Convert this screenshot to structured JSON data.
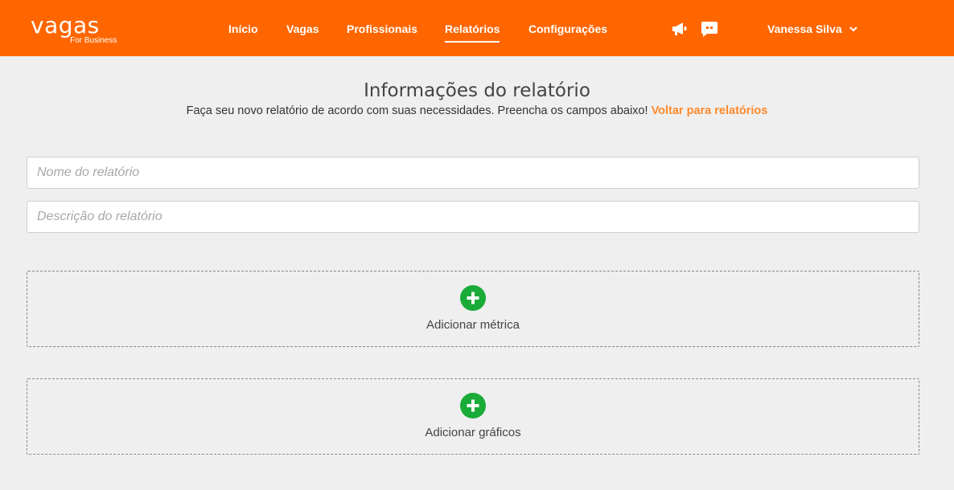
{
  "app": {
    "logo_main": "vagas",
    "logo_sub": "For Business"
  },
  "nav": {
    "items": [
      {
        "label": "Início"
      },
      {
        "label": "Vagas"
      },
      {
        "label": "Profissionais"
      },
      {
        "label": "Relatórios",
        "active": true
      },
      {
        "label": "Configurações"
      }
    ]
  },
  "header_icons": [
    "megaphone-icon",
    "chat-icon"
  ],
  "user": {
    "name": "Vanessa Silva"
  },
  "page": {
    "title": "Informações do relatório",
    "subtitle": "Faça seu novo relatório de acordo com suas necessidades. Preencha os campos abaixo!",
    "back_link": "Voltar para relatórios"
  },
  "form": {
    "name_placeholder": "Nome do relatório",
    "name_value": "",
    "description_placeholder": "Descrição do relatório",
    "description_value": ""
  },
  "actions": {
    "add_metric": "Adicionar métrica",
    "add_charts": "Adicionar gráficos"
  },
  "colors": {
    "brand": "#ff6600",
    "link": "#ff8a2b",
    "add_icon": "#1aab39"
  }
}
